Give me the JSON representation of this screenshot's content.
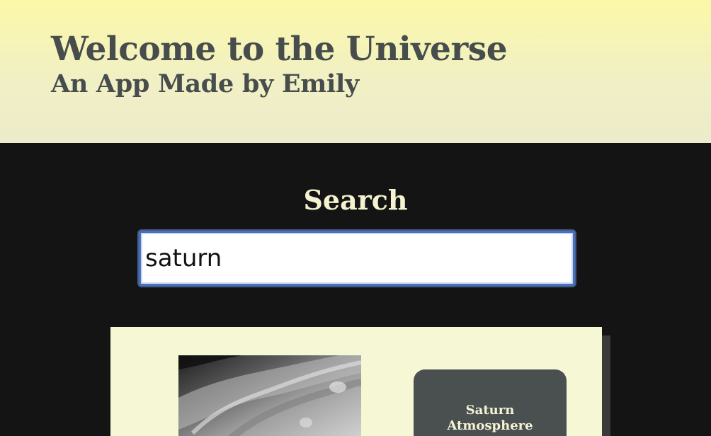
{
  "header": {
    "title": "Welcome to the Universe",
    "subtitle": "An App Made by Emily"
  },
  "search": {
    "heading": "Search",
    "value": "saturn"
  },
  "results": [
    {
      "image_icon": "saturn-atmosphere-photo",
      "button_line1": "Saturn",
      "button_line2": "Atmosphere"
    }
  ],
  "colors": {
    "header_top": "#fbf8a8",
    "header_bottom": "#ecebcb",
    "title_text": "#474c4c",
    "main_bg": "#141414",
    "heading_text": "#f4f2cf",
    "card_bg": "#f6f7d4",
    "button_bg": "#4a5050",
    "input_focus": "#4a6fbd"
  }
}
